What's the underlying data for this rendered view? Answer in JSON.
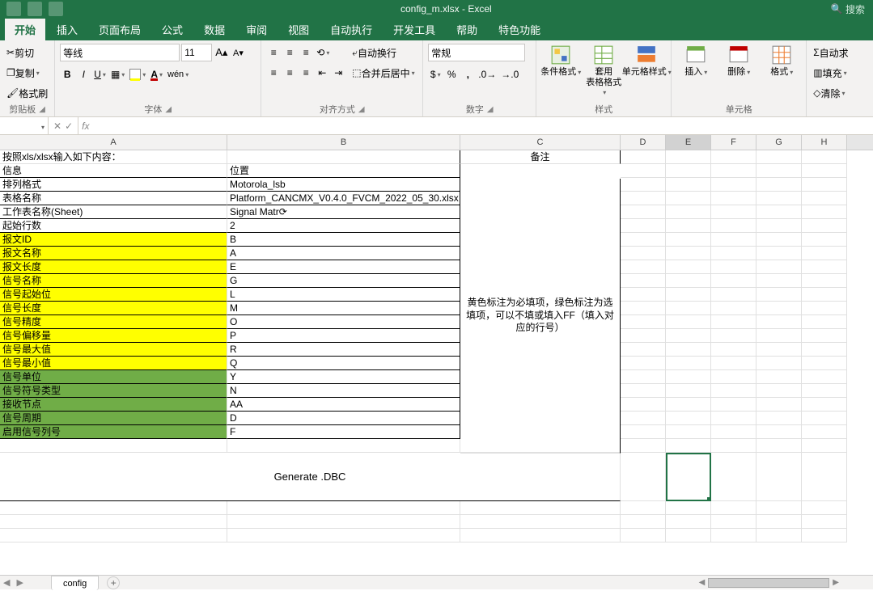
{
  "titlebar": {
    "filename": "config_m.xlsx - Excel",
    "search_placeholder": "搜索"
  },
  "tabs": {
    "start": "开始",
    "insert": "插入",
    "pagelayout": "页面布局",
    "formulas": "公式",
    "data": "数据",
    "review": "审阅",
    "view": "视图",
    "automate": "自动执行",
    "developer": "开发工具",
    "help": "帮助",
    "special": "特色功能"
  },
  "ribbon": {
    "clipboard": {
      "cut": "剪切",
      "copy": "复制",
      "paste_format": "格式刷",
      "group": "剪贴板"
    },
    "font": {
      "name": "等线",
      "size": "11",
      "group": "字体"
    },
    "align": {
      "wrap": "自动换行",
      "merge": "合并后居中",
      "group": "对齐方式"
    },
    "number": {
      "format": "常规",
      "group": "数字"
    },
    "styles": {
      "cond": "条件格式",
      "table": "套用\n表格格式",
      "cell": "单元格样式",
      "group": "样式"
    },
    "cells": {
      "insert": "插入",
      "delete": "删除",
      "format": "格式",
      "group": "单元格"
    },
    "editing": {
      "autosum": "自动求",
      "fill": "填充",
      "clear": "清除"
    }
  },
  "formula_bar": {
    "cell_ref": "",
    "fx": "fx",
    "value": ""
  },
  "columns": [
    "A",
    "B",
    "C",
    "D",
    "E",
    "F",
    "G",
    "H"
  ],
  "rows": {
    "r0": {
      "a": "按照xls/xlsx输入如下内容：",
      "b": "",
      "c": "备注"
    },
    "r1": {
      "a": "信息",
      "b": "位置",
      "cls": ""
    },
    "r2": {
      "a": "排列格式",
      "b": "Motorola_lsb",
      "cls": ""
    },
    "r3": {
      "a": "表格名称",
      "b": "Platform_CANCMX_V0.4.0_FVCM_2022_05_30.xlsx",
      "cls": ""
    },
    "r4": {
      "a": "工作表名称(Sheet)",
      "b": "Signal Matr⟳",
      "cls": ""
    },
    "r5": {
      "a": "起始行数",
      "b": "2",
      "cls": ""
    },
    "r6": {
      "a": "报文ID",
      "b": "B",
      "cls": "yellow"
    },
    "r7": {
      "a": "报文名称",
      "b": "A",
      "cls": "yellow"
    },
    "r8": {
      "a": "报文长度",
      "b": "E",
      "cls": "yellow"
    },
    "r9": {
      "a": "信号名称",
      "b": "G",
      "cls": "yellow"
    },
    "r10": {
      "a": "信号起始位",
      "b": "L",
      "cls": "yellow"
    },
    "r11": {
      "a": "信号长度",
      "b": "M",
      "cls": "yellow"
    },
    "r12": {
      "a": "信号精度",
      "b": "O",
      "cls": "yellow"
    },
    "r13": {
      "a": "信号偏移量",
      "b": "P",
      "cls": "yellow"
    },
    "r14": {
      "a": "信号最大值",
      "b": "R",
      "cls": "yellow"
    },
    "r15": {
      "a": "信号最小值",
      "b": "Q",
      "cls": "yellow"
    },
    "r16": {
      "a": "信号单位",
      "b": "Y",
      "cls": "green"
    },
    "r17": {
      "a": "信号符号类型",
      "b": "N",
      "cls": "green"
    },
    "r18": {
      "a": "接收节点",
      "b": "AA",
      "cls": "green"
    },
    "r19": {
      "a": "信号周期",
      "b": "D",
      "cls": "green"
    },
    "r20": {
      "a": "启用信号列号",
      "b": "F",
      "cls": "green"
    },
    "note": "黄色标注为必填项，绿色标注为选填项，可以不填或填入FF（填入对应的行号）",
    "generate": "Generate .DBC"
  },
  "sheet_tabs": {
    "config": "config"
  }
}
